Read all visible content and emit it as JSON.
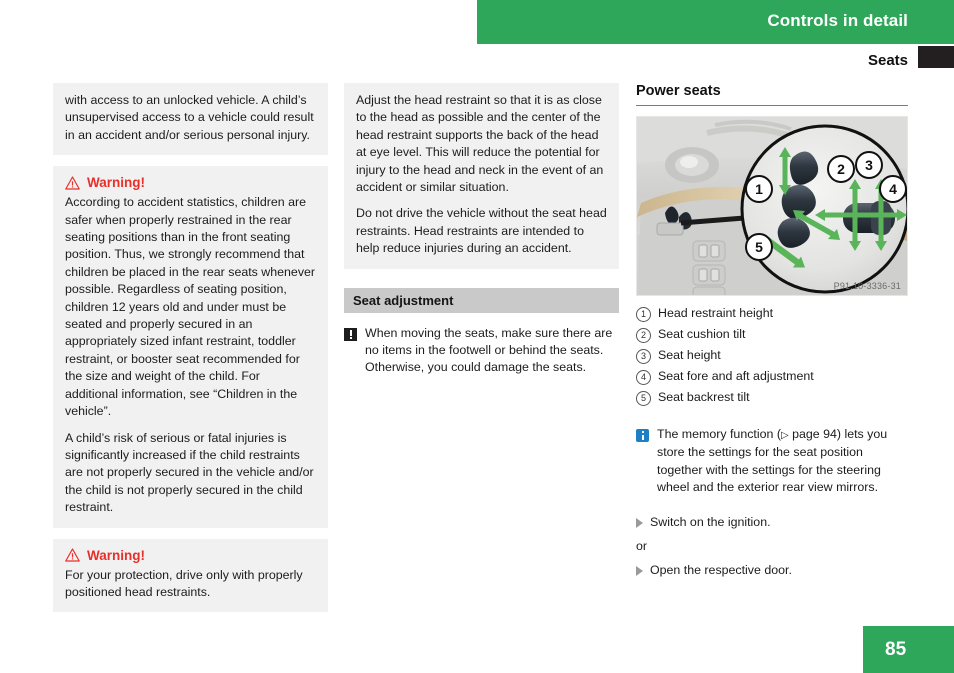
{
  "header": {
    "chapter_title": "Controls in detail",
    "section_title": "Seats"
  },
  "column1": {
    "note1": {
      "paragraphs": [
        "with access to an unlocked vehicle. A child’s unsupervised access to a vehicle could result in an accident and/or serious personal injury."
      ]
    },
    "warning1": {
      "label": "Warning!",
      "paragraphs": [
        "According to accident statistics, children are safer when properly restrained in the rear seating positions than in the front seating position. Thus, we strongly recommend that children be placed in the rear seats whenever possible. Regardless of seating position, children 12 years old and under must be seated and properly secured in an appropriately sized infant restraint, toddler restraint, or booster seat recommended for the size and weight of the child. For additional information, see “Children in the vehicle”.",
        "A child’s risk of serious or fatal injuries is significantly increased if the child restraints are not properly secured in the vehicle and/or the child is not properly secured in the child restraint."
      ]
    },
    "warning2": {
      "label": "Warning!",
      "paragraphs": [
        "For your protection, drive only with properly positioned head restraints."
      ]
    }
  },
  "column2": {
    "note1": {
      "paragraphs": [
        "Adjust the head restraint so that it is as close to the head as possible and the center of the head restraint supports the back of the head at eye level. This will reduce the potential for injury to the head and neck in the event of an accident or similar situation.",
        "Do not drive the vehicle without the seat head restraints. Head restraints are intended to help reduce injuries during an accident."
      ]
    },
    "subsection_heading": "Seat adjustment",
    "caution": {
      "text": "When moving the seats, make sure there are no items in the footwell or behind the seats. Otherwise, you could damage the seats."
    }
  },
  "column3": {
    "heading": "Power seats",
    "figure": {
      "caption": "P91.10-3336-31",
      "alt_name": "door-seat-control-panel-diagram",
      "callout_numbers": [
        "1",
        "2",
        "3",
        "4",
        "5"
      ]
    },
    "legend": [
      {
        "num": "1",
        "label": "Head restraint height"
      },
      {
        "num": "2",
        "label": "Seat cushion tilt"
      },
      {
        "num": "3",
        "label": "Seat height"
      },
      {
        "num": "4",
        "label": "Seat fore and aft adjustment"
      },
      {
        "num": "5",
        "label": "Seat backrest tilt"
      }
    ],
    "info_note": {
      "text_before_ref": "The memory function (",
      "ref_arrow": "▷",
      "ref_text": " page 94",
      "text_after_ref": ") lets you store the settings for the seat position together with the settings for the steering wheel and the exterior rear view mirrors."
    },
    "steps": [
      {
        "type": "step",
        "text": "Switch on the ignition."
      },
      {
        "type": "or",
        "text": "or"
      },
      {
        "type": "step",
        "text": "Open the respective door."
      }
    ]
  },
  "footer": {
    "page_number": "85"
  },
  "colors": {
    "brand_green": "#2ea75a",
    "warning_red": "#e8302a",
    "info_blue": "#1f7fc4",
    "note_gray": "#f1f1f1",
    "bar_gray": "#c9c9c9",
    "black_tab": "#231f20"
  }
}
